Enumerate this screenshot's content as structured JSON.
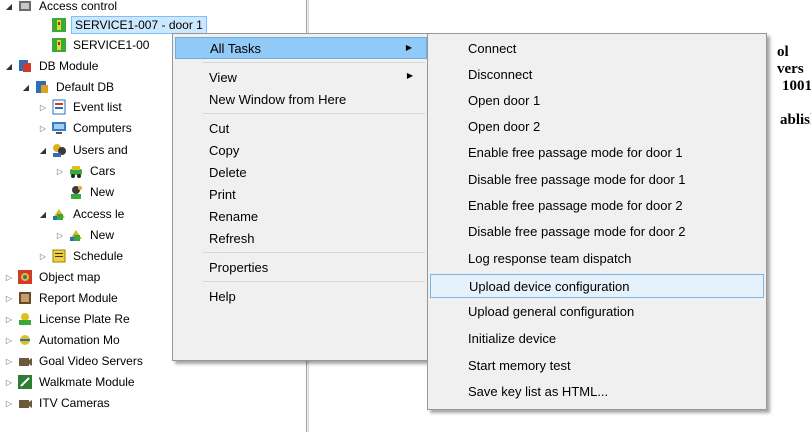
{
  "tree": {
    "rows": [
      {
        "label": "Access control",
        "indent": 0,
        "expander": "open",
        "icon": "access-control-icon"
      },
      {
        "label": "SERVICE1-007 - door 1",
        "indent": 2,
        "expander": "none",
        "icon": "door-controller-icon",
        "selected": true
      },
      {
        "label": "SERVICE1-00",
        "indent": 2,
        "expander": "none",
        "icon": "door-controller-icon"
      },
      {
        "label": "DB Module",
        "indent": 0,
        "expander": "open",
        "icon": "db-module-icon"
      },
      {
        "label": "Default DB",
        "indent": 1,
        "expander": "open",
        "icon": "database-icon"
      },
      {
        "label": "Event list",
        "indent": 2,
        "expander": "closed",
        "icon": "event-list-icon"
      },
      {
        "label": "Computers",
        "indent": 2,
        "expander": "closed",
        "icon": "computer-icon"
      },
      {
        "label": "Users and",
        "indent": 2,
        "expander": "open",
        "icon": "users-icon"
      },
      {
        "label": "Cars",
        "indent": 3,
        "expander": "closed",
        "icon": "car-icon"
      },
      {
        "label": "New",
        "indent": 3,
        "expander": "none",
        "icon": "new-user-icon"
      },
      {
        "label": "Access le",
        "indent": 2,
        "expander": "open",
        "icon": "access-levels-icon"
      },
      {
        "label": "New",
        "indent": 3,
        "expander": "closed",
        "icon": "access-levels-icon"
      },
      {
        "label": "Schedule",
        "indent": 2,
        "expander": "closed",
        "icon": "schedule-icon"
      },
      {
        "label": "Object map",
        "indent": 0,
        "expander": "closed",
        "icon": "object-map-icon"
      },
      {
        "label": "Report Module",
        "indent": 0,
        "expander": "closed",
        "icon": "report-icon"
      },
      {
        "label": "License Plate Re",
        "indent": 0,
        "expander": "closed",
        "icon": "license-plate-icon"
      },
      {
        "label": "Automation Mo",
        "indent": 0,
        "expander": "closed",
        "icon": "automation-icon"
      },
      {
        "label": "Goal Video Servers",
        "indent": 0,
        "expander": "closed",
        "icon": "video-server-icon"
      },
      {
        "label": "Walkmate Module",
        "indent": 0,
        "expander": "closed",
        "icon": "walkmate-icon"
      },
      {
        "label": "ITV Cameras",
        "indent": 0,
        "expander": "closed",
        "icon": "camera-icon"
      }
    ]
  },
  "right_pane": {
    "lines": [
      "ol vers",
      "1001",
      "ablish"
    ]
  },
  "context_menu": {
    "items": [
      {
        "label": "All Tasks",
        "has_submenu": true,
        "highlighted": true
      },
      {
        "separator": true
      },
      {
        "label": "View",
        "has_submenu": true
      },
      {
        "label": "New Window from Here"
      },
      {
        "separator": true
      },
      {
        "label": "Cut"
      },
      {
        "label": "Copy"
      },
      {
        "label": "Delete"
      },
      {
        "label": "Print"
      },
      {
        "label": "Rename"
      },
      {
        "label": "Refresh"
      },
      {
        "separator": true
      },
      {
        "label": "Properties"
      },
      {
        "separator": true
      },
      {
        "label": "Help"
      }
    ]
  },
  "submenu": {
    "items": [
      {
        "label": "Connect"
      },
      {
        "label": "Disconnect"
      },
      {
        "label": "Open door 1"
      },
      {
        "label": "Open door 2"
      },
      {
        "label": "Enable free passage mode for door 1"
      },
      {
        "label": "Disable free passage mode for door 1"
      },
      {
        "label": "Enable free passage mode for door 2"
      },
      {
        "label": "Disable free passage mode for door 2"
      },
      {
        "label": "Log response team dispatch"
      },
      {
        "label": "Upload device configuration",
        "highlighted": true
      },
      {
        "label": "Upload general configuration"
      },
      {
        "label": "Initialize device"
      },
      {
        "label": "Start memory test"
      },
      {
        "label": "Save key list as HTML..."
      }
    ]
  },
  "colors": {
    "selection": "#cce8ff",
    "menu_highlight": "#91c9f7",
    "submenu_highlight": "#e5f1fb",
    "menu_bg": "#f0f0f0"
  }
}
